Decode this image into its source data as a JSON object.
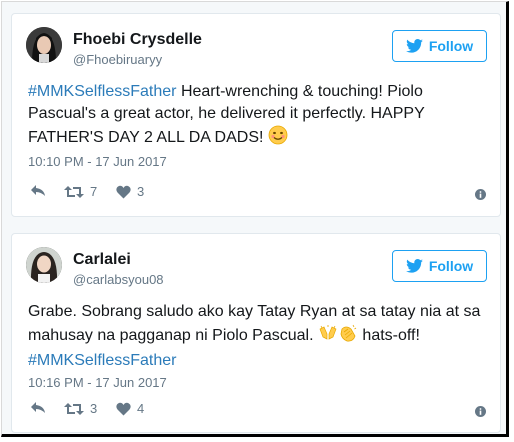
{
  "tweets": [
    {
      "name": "Fhoebi Crysdelle",
      "handle": "@Fhoebiruaryy",
      "follow_label": "Follow",
      "hashtag": "#MMKSelflessFather",
      "text_after_hashtag": " Heart-wrenching & touching! Piolo Pascual's a great actor, he delivered it perfectly. HAPPY FATHER'S DAY 2 ALL DA DADS! ",
      "timestamp": "10:10 PM - 17 Jun 2017",
      "retweets": "7",
      "likes": "3",
      "icons": [
        "reply-icon",
        "retweet-icon",
        "heart-icon",
        "info-icon",
        "smiling-face-emoji"
      ]
    },
    {
      "name": "Carlalei",
      "handle": "@carlabsyou08",
      "follow_label": "Follow",
      "text_before_emoji": "Grabe. Sobrang saludo ako kay Tatay Ryan at sa tatay nia at sa mahusay na pagganap ni Piolo Pascual. ",
      "text_after_emoji": " hats-off!",
      "hashtag": "#MMKSelflessFather",
      "timestamp": "10:16 PM - 17 Jun 2017",
      "retweets": "3",
      "likes": "4",
      "icons": [
        "reply-icon",
        "retweet-icon",
        "heart-icon",
        "info-icon",
        "raised-hands-emoji",
        "clapping-hands-emoji"
      ]
    }
  ],
  "colors": {
    "accent": "#1da1f2",
    "hashtag": "#2b7bb9",
    "muted": "#657786",
    "text": "#14171a",
    "border": "#e1e8ed"
  }
}
